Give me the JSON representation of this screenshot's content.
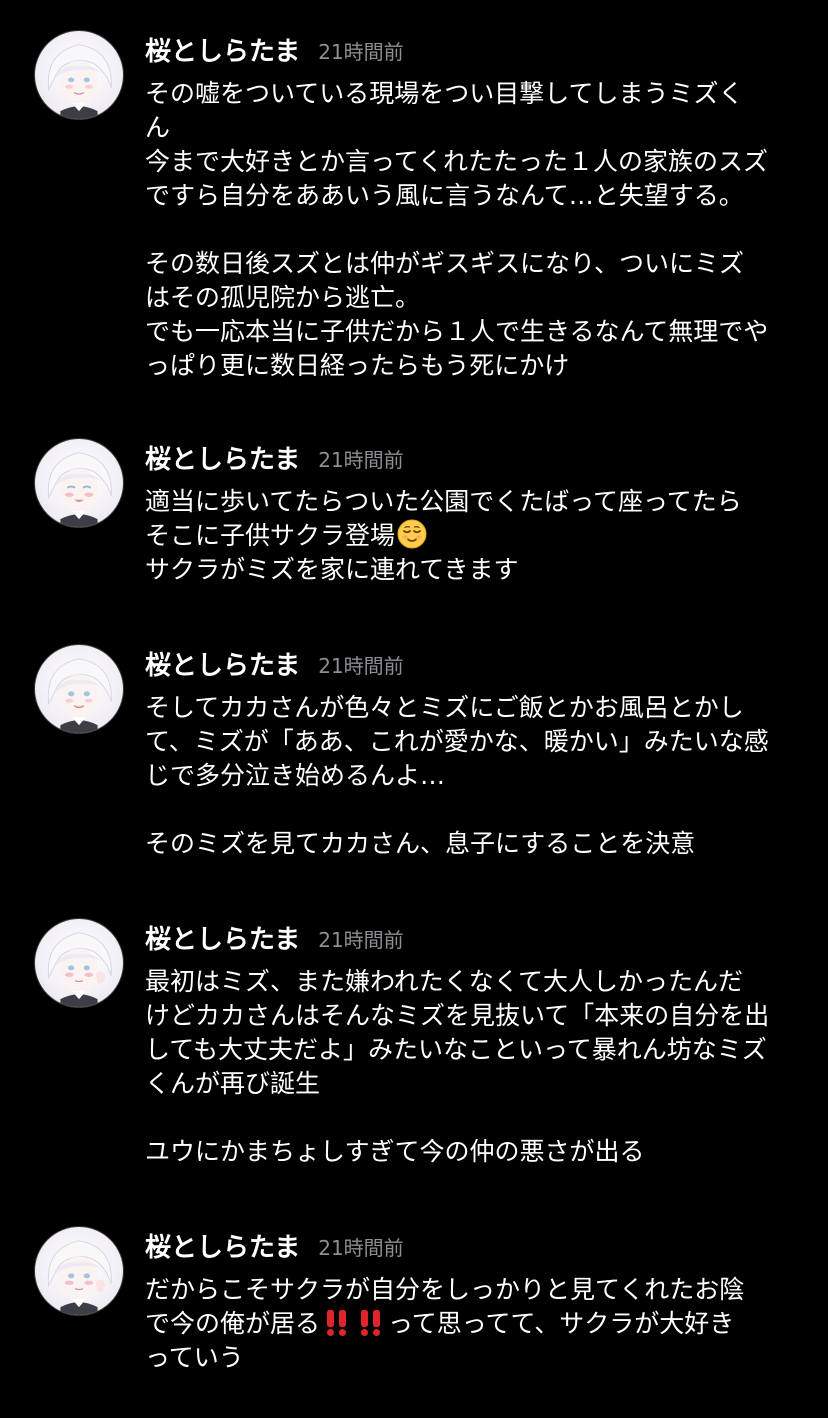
{
  "comments": [
    {
      "username": "桜としらたま",
      "timestamp": "21時間前",
      "lines": [
        "その嘘をついている現場をつい目撃してしまうミズく",
        "ん",
        "今まで大好きとか言ってくれたたった１人の家族のスズ",
        "ですら自分をああいう風に言うなんて…と失望する。",
        "",
        "その数日後スズとは仲がギスギスになり、ついにミズ",
        "はその孤児院から逃亡。",
        "でも一応本当に子供だから１人で生きるなんて無理でや",
        "っぱり更に数日経ったらもう死にかけ"
      ]
    },
    {
      "username": "桜としらたま",
      "timestamp": "21時間前",
      "lines": [
        "適当に歩いてたらついた公園でくたばって座ってたら",
        "そこに子供サクラ登場",
        "サクラがミズを家に連れてきます"
      ],
      "emoji": "relieved-face"
    },
    {
      "username": "桜としらたま",
      "timestamp": "21時間前",
      "lines": [
        "そしてカカさんが色々とミズにご飯とかお風呂とかし",
        "て、ミズが「ああ、これが愛かな、暖かい」みたいな感",
        "じで多分泣き始めるんよ…",
        "",
        "そのミズを見てカカさん、息子にすることを決意"
      ]
    },
    {
      "username": "桜としらたま",
      "timestamp": "21時間前",
      "lines": [
        "最初はミズ、また嫌われたくなくて大人しかったんだ",
        "けどカカさんはそんなミズを見抜いて「本来の自分を出",
        "しても大丈夫だよ」みたいなこといって暴れん坊なミズ",
        "くんが再び誕生",
        "",
        "ユウにかまちょしすぎて今の仲の悪さが出る"
      ]
    },
    {
      "username": "桜としらたま",
      "timestamp": "21時間前",
      "lines": [
        "だからこそサクラが自分をしっかりと見てくれたお陰",
        "で今の俺が居る",
        "って思ってて、サクラが大好き",
        "っていう"
      ],
      "emoji": "double-exclamation-mark"
    }
  ],
  "colors": {
    "background": "#000000",
    "text": "#ffffff",
    "timestamp": "#8e8e93",
    "exclamation": "#e0242b"
  }
}
